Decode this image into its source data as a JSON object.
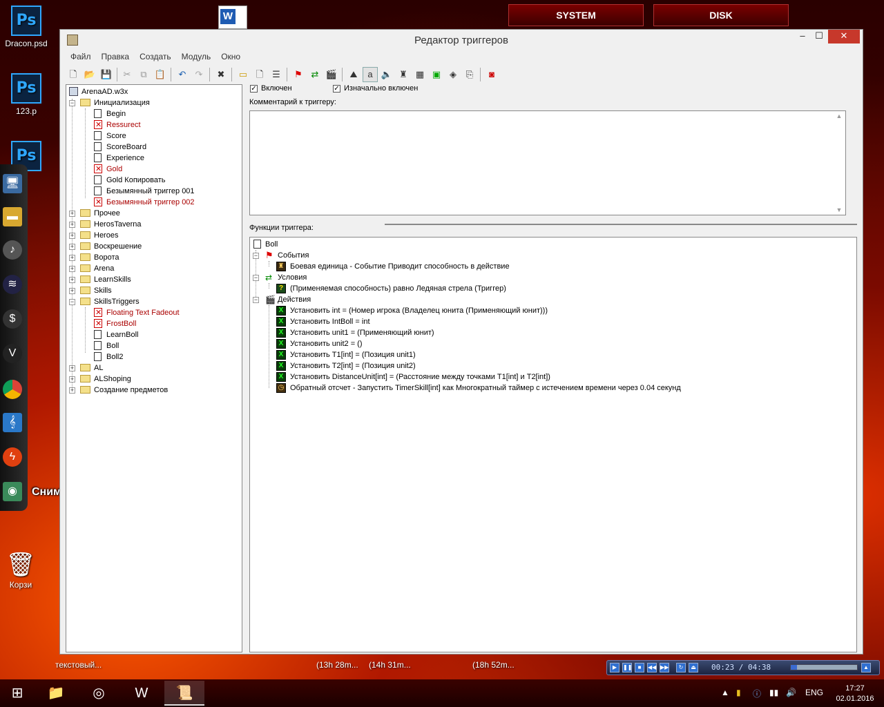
{
  "desktop": {
    "icons": [
      {
        "label": "Dracon.psd",
        "glyph": "Ps"
      },
      {
        "label": "123.p",
        "glyph": "Ps"
      },
      {
        "label": "",
        "glyph": "Ps"
      },
      {
        "label": "Корзи",
        "glyph": "🗑"
      }
    ],
    "top_buttons": [
      "SYSTEM",
      "DISK"
    ],
    "screenshot_tooltip": "Снимок экрана"
  },
  "window": {
    "title": "Редактор триггеров",
    "controls": {
      "minimize": "‒",
      "maximize": "☐",
      "close": "✕"
    },
    "menu": [
      "Файл",
      "Правка",
      "Создать",
      "Модуль",
      "Окно"
    ]
  },
  "tree": {
    "root": "ArenaAD.w3x",
    "rows": [
      {
        "label": "Инициализация",
        "kind": "folder",
        "expander": "−",
        "disabled": false
      },
      {
        "label": "Begin",
        "kind": "trigger",
        "disabled": false
      },
      {
        "label": "Ressurect",
        "kind": "trigger",
        "disabled": true
      },
      {
        "label": "Score",
        "kind": "trigger",
        "disabled": false
      },
      {
        "label": "ScoreBoard",
        "kind": "trigger",
        "disabled": false
      },
      {
        "label": "Experience",
        "kind": "trigger",
        "disabled": false
      },
      {
        "label": "Gold",
        "kind": "trigger",
        "disabled": true
      },
      {
        "label": "Gold Копировать",
        "kind": "trigger",
        "disabled": false
      },
      {
        "label": "Безымянный триггер 001",
        "kind": "trigger",
        "disabled": false
      },
      {
        "label": "Безымянный триггер 002",
        "kind": "trigger",
        "disabled": true
      },
      {
        "label": "Прочее",
        "kind": "folder",
        "expander": "+",
        "disabled": false
      },
      {
        "label": "HerosTaverna",
        "kind": "folder",
        "expander": "+",
        "disabled": false
      },
      {
        "label": "Heroes",
        "kind": "folder",
        "expander": "+",
        "disabled": false
      },
      {
        "label": "Воскрешение",
        "kind": "folder",
        "expander": "+",
        "disabled": false
      },
      {
        "label": "Ворота",
        "kind": "folder",
        "expander": "+",
        "disabled": false
      },
      {
        "label": "Arena",
        "kind": "folder",
        "expander": "+",
        "disabled": false
      },
      {
        "label": "LearnSkills",
        "kind": "folder",
        "expander": "+",
        "disabled": false
      },
      {
        "label": "Skills",
        "kind": "folder",
        "expander": "+",
        "disabled": false
      },
      {
        "label": "SkillsTriggers",
        "kind": "folder",
        "expander": "−",
        "disabled": false
      },
      {
        "label": "Floating Text Fadeout",
        "kind": "trigger",
        "disabled": true
      },
      {
        "label": "FrostBoll",
        "kind": "trigger",
        "disabled": true
      },
      {
        "label": "LearnBoll",
        "kind": "trigger",
        "disabled": false
      },
      {
        "label": "Boll",
        "kind": "trigger",
        "disabled": false
      },
      {
        "label": "Boll2",
        "kind": "trigger",
        "disabled": false
      },
      {
        "label": "AL",
        "kind": "folder",
        "expander": "+",
        "disabled": false
      },
      {
        "label": "ALShoping",
        "kind": "folder",
        "expander": "+",
        "disabled": false
      },
      {
        "label": "Создание предметов",
        "kind": "folder",
        "expander": "+",
        "disabled": false
      }
    ]
  },
  "trigger": {
    "enabled_label": "Включен",
    "enabled": true,
    "initially_on_label": "Изначально включен",
    "initially_on": true,
    "comment_label": "Комментарий к триггеру:",
    "comment_value": "",
    "functions_label": "Функции триггера:",
    "name": "Boll",
    "events_label": "События",
    "events": [
      "Боевая единица - Событие Приводит способность в действие"
    ],
    "conditions_label": "Условия",
    "conditions": [
      "(Применяемая способность) равно Ледяная стрела (Триггер)"
    ],
    "actions_label": "Действия",
    "actions": [
      {
        "text": "Установить int = (Номер игрока (Владелец юнита (Применяющий юнит)))",
        "icon": "set"
      },
      {
        "text": "Установить IntBoll = int",
        "icon": "set"
      },
      {
        "text": "Установить unit1 = (Применяющий юнит)",
        "icon": "set"
      },
      {
        "text": "Установить unit2 = ()",
        "icon": "set"
      },
      {
        "text": "Установить T1[int] = (Позиция unit1)",
        "icon": "set"
      },
      {
        "text": "Установить T2[int] = (Позиция unit2)",
        "icon": "set"
      },
      {
        "text": "Установить DistanceUnit[int] = (Расстояние между точками T1[int] и T2[int])",
        "icon": "set"
      },
      {
        "text": "Обратный отсчет - Запустить TimerSkill[int] как Многократный таймер с истечением времени через 0.04 секунд",
        "icon": "timer"
      }
    ]
  },
  "taskbar": {
    "floating_labels": [
      "текстовый...",
      "(13h 28m...",
      "(14h 31m...",
      "(18h 52m..."
    ],
    "media_time": "00:23 / 04:38",
    "media_progress": 0.09,
    "language": "ENG",
    "time": "17:27",
    "date": "02.01.2016"
  }
}
